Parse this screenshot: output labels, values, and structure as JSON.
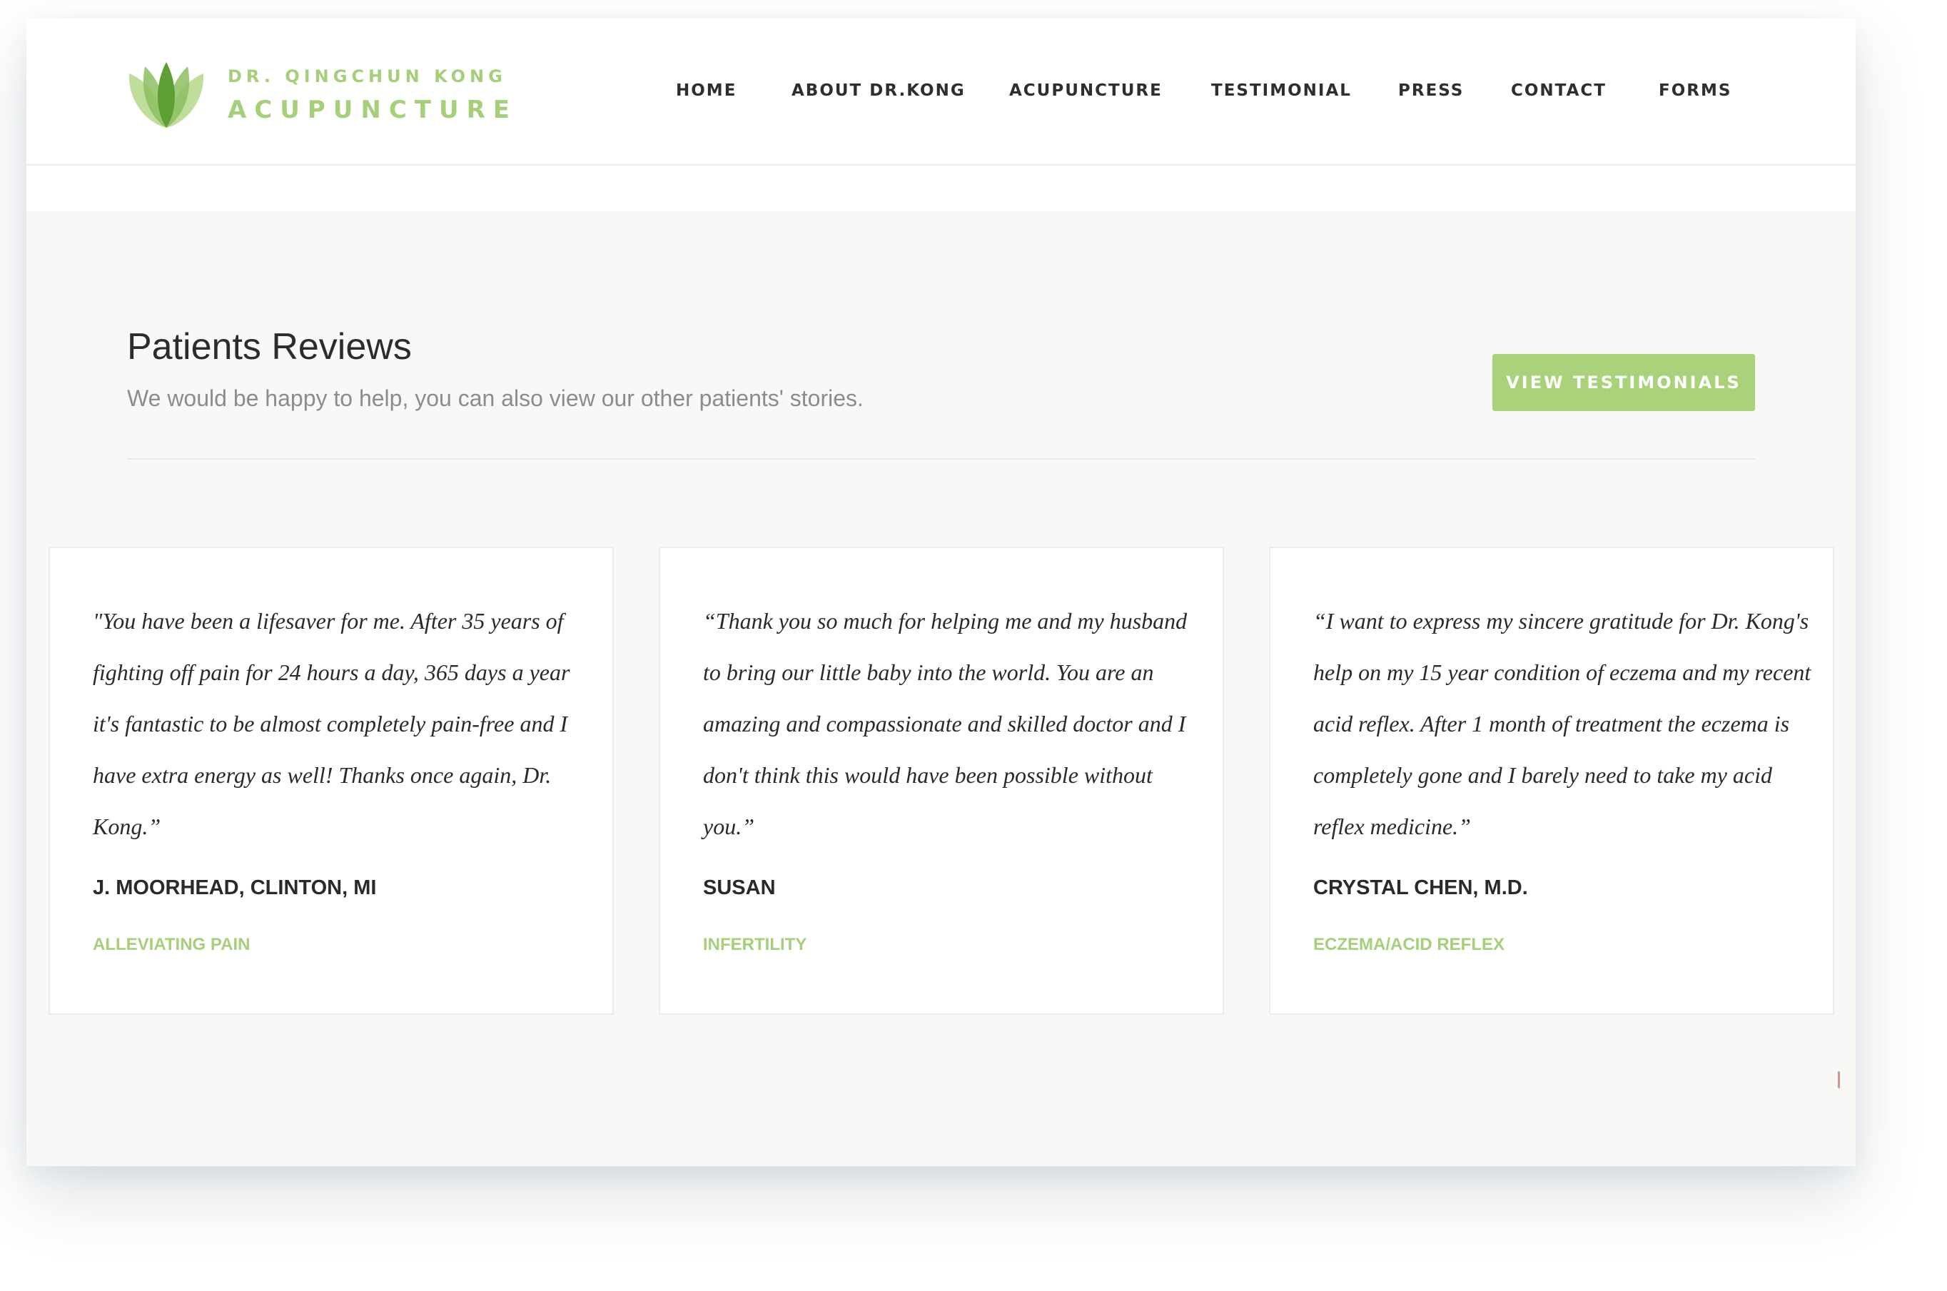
{
  "header": {
    "logo_line1": "DR. QINGCHUN KONG",
    "logo_line2": "ACUPUNCTURE",
    "logo_icon": "lotus-leaves-icon",
    "nav": [
      "HOME",
      "ABOUT DR.KONG",
      "ACUPUNCTURE",
      "TESTIMONIAL",
      "PRESS",
      "CONTACT",
      "FORMS"
    ]
  },
  "reviews": {
    "title": "Patients Reviews",
    "subtitle": "We would be happy to help, you can also view our other patients' stories.",
    "button_label": "VIEW TESTIMONIALS",
    "cards": [
      {
        "quote": "\"You have been a lifesaver for me. After 35 years of fighting off pain for 24 hours a day, 365 days a year it's fantastic to be almost completely pain-free and I have extra energy as well! Thanks once again, Dr. Kong.”",
        "author": "J. MOORHEAD, CLINTON, MI",
        "category": "ALLEVIATING PAIN"
      },
      {
        "quote": "“Thank you so much for helping me and my husband to bring our little baby into the world. You are an amazing and compassionate and skilled doctor and I don't think this would have been possible without you.”",
        "author": "SUSAN",
        "category": "INFERTILITY"
      },
      {
        "quote": "“I want to express my sincere gratitude for Dr. Kong's help on my 15 year condition of eczema and my recent acid reflex. After 1 month of treatment the eczema is completely gone and I barely need to take my acid reflex medicine.”",
        "author": "CRYSTAL CHEN, M.D.",
        "category": "ECZEMA/ACID REFLEX"
      }
    ]
  },
  "colors": {
    "accent": "#a9d27a",
    "text_dark": "#2a2a2a",
    "text_muted": "#8c8c8c",
    "section_bg": "#f8f8f6"
  }
}
